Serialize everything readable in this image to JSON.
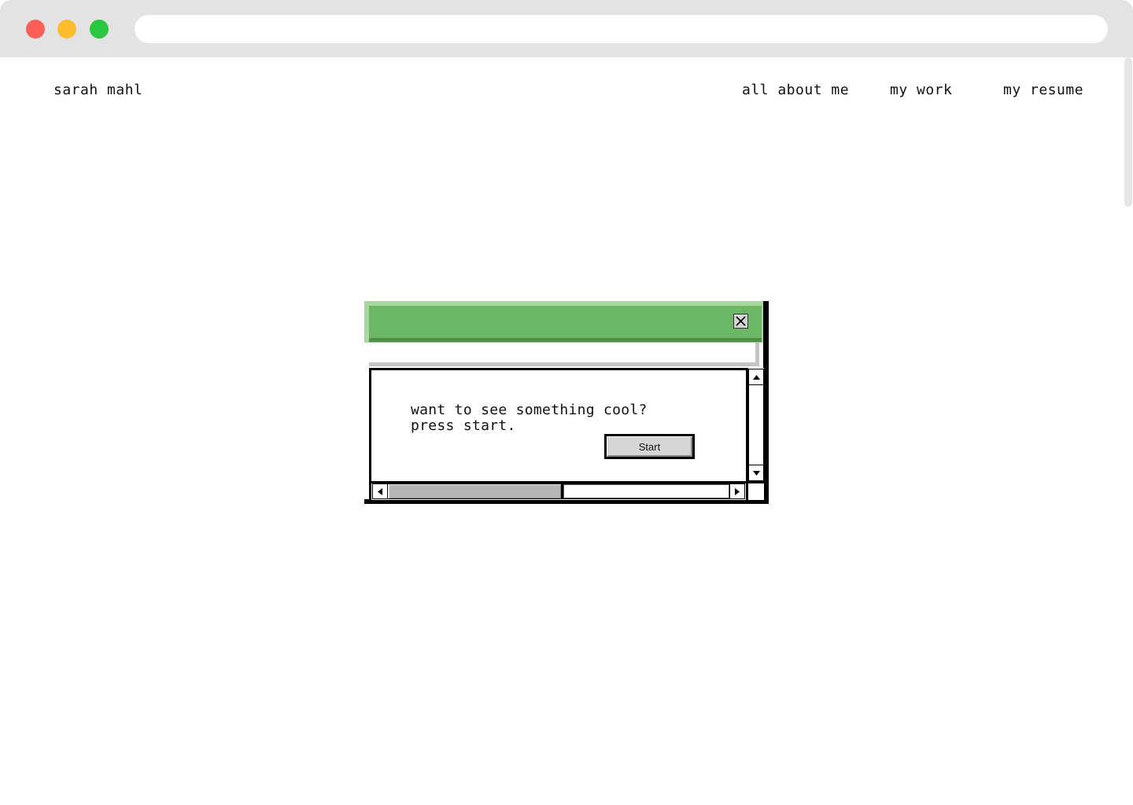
{
  "browser": {
    "address_value": "",
    "traffic_lights": {
      "close_color": "#fe5f57",
      "minimize_color": "#febc2e",
      "zoom_color": "#28c840"
    }
  },
  "header": {
    "site_name": "sarah mahl",
    "nav": [
      {
        "label": "all about me"
      },
      {
        "label": "my work"
      },
      {
        "label": "my resume"
      }
    ]
  },
  "window": {
    "title_bar_color": "#6db866",
    "close_icon": "close-x-icon",
    "message_line_1": "want to see something cool?",
    "message_line_2": "press start.",
    "start_button_label": "Start",
    "scroll_icons": [
      "arrow-up-icon",
      "arrow-down-icon",
      "arrow-left-icon",
      "arrow-right-icon"
    ]
  }
}
